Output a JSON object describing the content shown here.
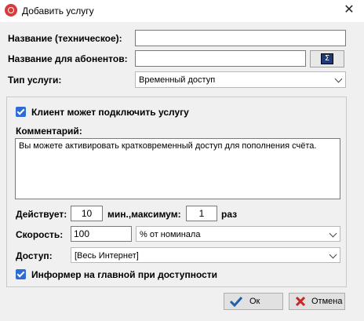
{
  "window": {
    "title": "Добавить услугу",
    "close_glyph": "✕"
  },
  "form": {
    "tech_name_label": "Название (техническое):",
    "tech_name_value": "",
    "subscriber_name_label": "Название для абонентов:",
    "subscriber_name_value": "",
    "sigma_glyph": "Σ",
    "service_type_label": "Тип услуги:",
    "service_type_value": "Временный доступ"
  },
  "group": {
    "client_can_connect_label": "Клиент может подключить услугу",
    "client_can_connect_checked": true,
    "comment_label": "Комментарий:",
    "comment_text": "Вы можете активировать кратковременный доступ для пополнения счёта.",
    "duration_label": "Действует:",
    "duration_value": "10",
    "minutes_max_label": "мин.,максимум:",
    "max_times_value": "1",
    "times_label": "раз",
    "speed_label": "Скорость:",
    "speed_value": "100",
    "speed_unit_value": "% от номинала",
    "access_label": "Доступ:",
    "access_value": "[Весь Интернет]",
    "informer_label": "Информер на главной при доступности",
    "informer_checked": true
  },
  "buttons": {
    "ok_label": "Ок",
    "cancel_label": "Отмена"
  },
  "colors": {
    "checkbox": "#2f6bd6",
    "ok_check": "#1f5fa8",
    "cancel_x": "#c62828"
  }
}
